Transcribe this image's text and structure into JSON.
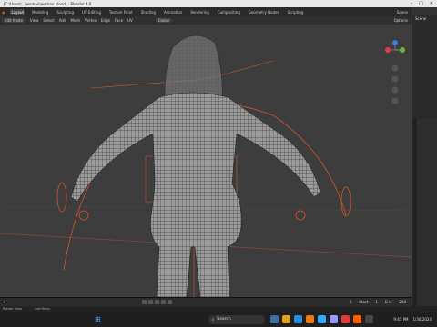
{
  "window": {
    "title": "[C:\\Users\\...\\woman\\woman.blend] - Blender 4.0"
  },
  "workspaces": [
    "Layout",
    "Modeling",
    "Sculpting",
    "UV Editing",
    "Texture Paint",
    "Shading",
    "Animation",
    "Rendering",
    "Compositing",
    "Geometry Nodes",
    "Scripting"
  ],
  "active_workspace": "Layout",
  "view3d_header": {
    "mode": "Edit Mode",
    "menus": [
      "View",
      "Select",
      "Add",
      "Mesh",
      "Vertex",
      "Edge",
      "Face",
      "UV"
    ],
    "transform_orientation": "Global",
    "options_label": "Options"
  },
  "outliner": {
    "title": "Scene"
  },
  "timeline": {
    "current_frame": "0",
    "start_label": "Start",
    "start": "1",
    "end_label": "End",
    "end": "250"
  },
  "statusbar": {
    "items": [
      "Rotate View",
      "Call Menu"
    ]
  },
  "taskbar": {
    "search_placeholder": "Search",
    "time": "9:41 PM",
    "date": "1/30/2024"
  },
  "colors": {
    "viewport_bg": "#3d3d3d",
    "accent_orange": "#e0582a",
    "wire": "#1a1a1a"
  }
}
